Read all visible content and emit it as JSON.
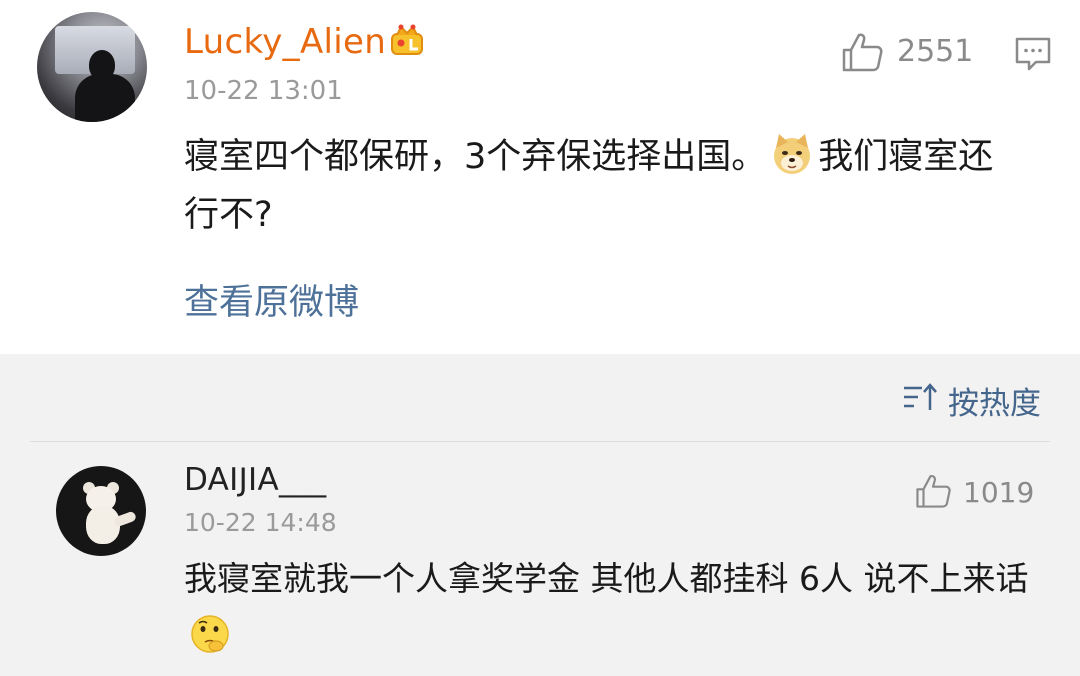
{
  "post": {
    "username": "Lucky_Alien",
    "badge_icon": "crown-badge-icon",
    "time": "10-22 13:01",
    "likes": "2551",
    "text_before_emoji": "寝室四个都保研，3个弃保选择出国。",
    "emoji": "doge-emoji",
    "text_after_emoji": "我们寝室还行不?",
    "view_original": "查看原微博"
  },
  "sort": {
    "icon": "sort-icon",
    "label": "按热度"
  },
  "comments": [
    {
      "username": "DAIJIA___",
      "time": "10-22 14:48",
      "likes": "1019",
      "text": "我寝室就我一个人拿奖学金 其他人都挂科 6人 说不上来话",
      "emoji": "thinking-emoji"
    }
  ],
  "colors": {
    "vip_name": "#e86a10",
    "link": "#4d7199",
    "meta": "#9a9a9a",
    "background": "#f2f2f2"
  }
}
